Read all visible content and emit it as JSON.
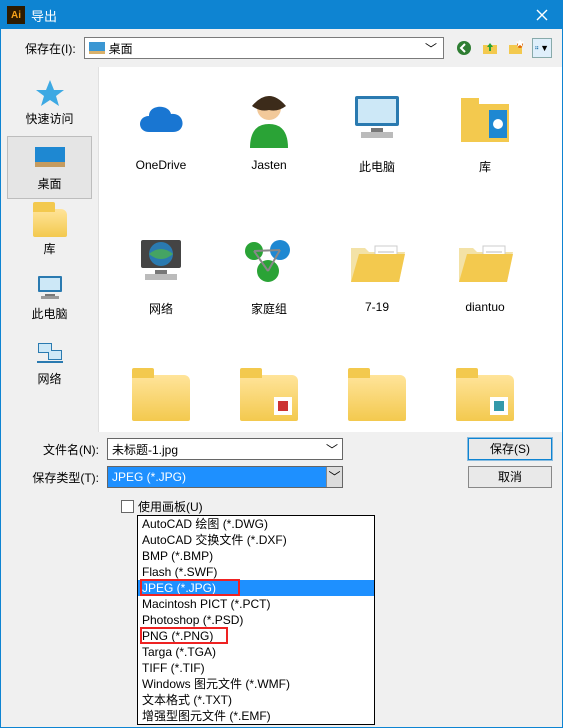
{
  "titlebar": {
    "title": "导出"
  },
  "toolbar": {
    "save_in_label": "保存在(I):",
    "location": "桌面"
  },
  "sidebar": {
    "items": [
      {
        "label": "快速访问"
      },
      {
        "label": "桌面"
      },
      {
        "label": "库"
      },
      {
        "label": "此电脑"
      },
      {
        "label": "网络"
      }
    ]
  },
  "files": {
    "row1": [
      {
        "label": "OneDrive"
      },
      {
        "label": "Jasten"
      },
      {
        "label": "此电脑"
      },
      {
        "label": "库"
      }
    ],
    "row2": [
      {
        "label": "网络"
      },
      {
        "label": "家庭组"
      },
      {
        "label": "7-19"
      },
      {
        "label": "diantuo"
      }
    ]
  },
  "form": {
    "filename_label": "文件名(N):",
    "filename_value": "未标题-1.jpg",
    "filetype_label": "保存类型(T):",
    "filetype_value": "JPEG (*.JPG)",
    "save_btn": "保存(S)",
    "cancel_btn": "取消",
    "use_artboard_label": "使用画板(U)"
  },
  "filetype_options": [
    "AutoCAD 绘图 (*.DWG)",
    "AutoCAD 交换文件 (*.DXF)",
    "BMP (*.BMP)",
    "Flash (*.SWF)",
    "JPEG (*.JPG)",
    "Macintosh PICT (*.PCT)",
    "Photoshop (*.PSD)",
    "PNG (*.PNG)",
    "Targa (*.TGA)",
    "TIFF (*.TIF)",
    "Windows 图元文件 (*.WMF)",
    "文本格式 (*.TXT)",
    "增强型图元文件 (*.EMF)"
  ]
}
